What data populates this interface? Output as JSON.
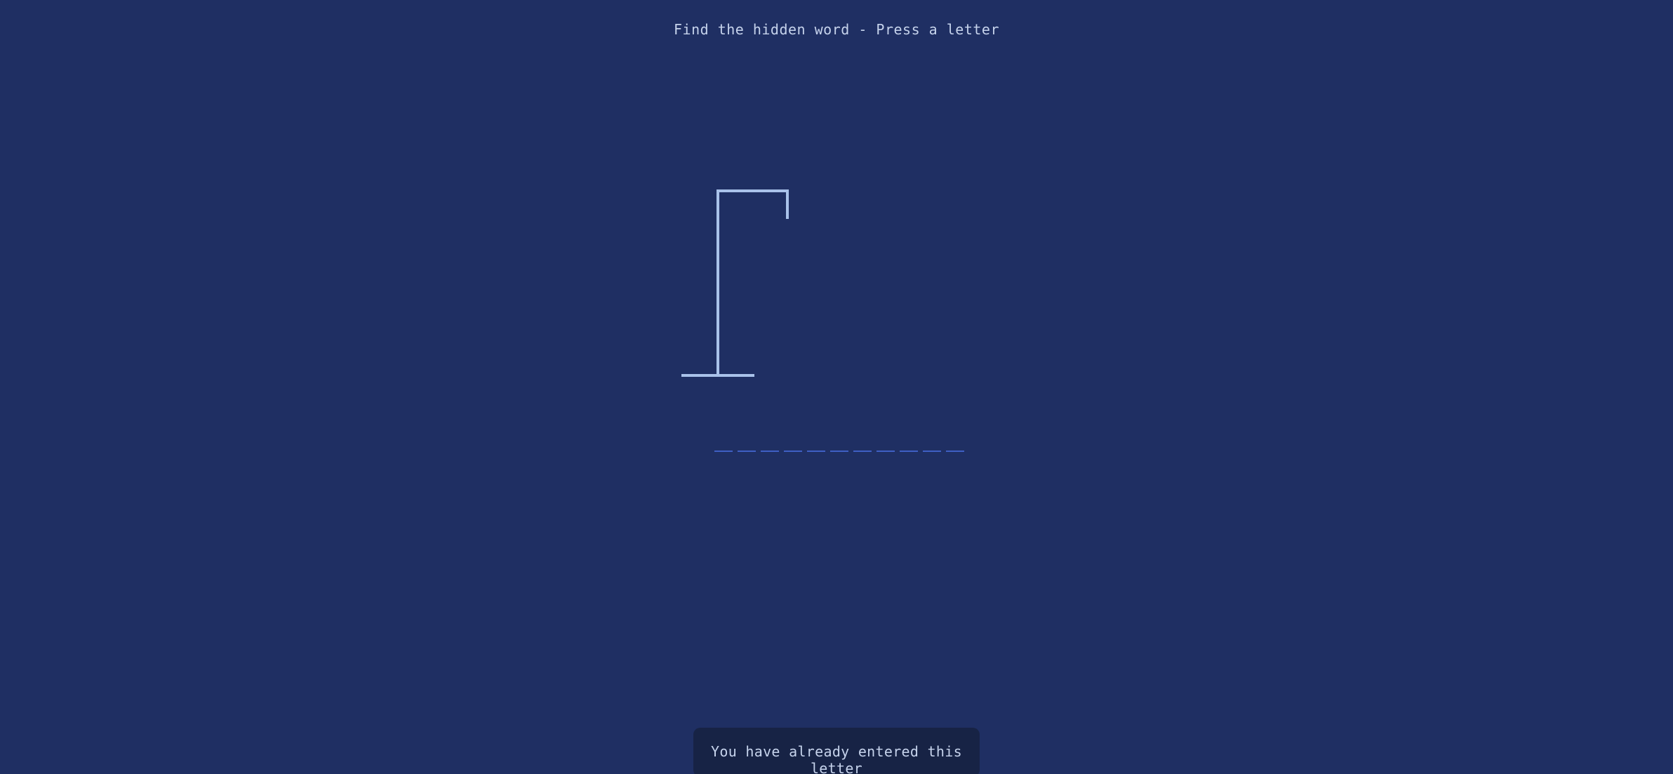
{
  "header": {
    "instruction": "Find the hidden word - Press a letter"
  },
  "game": {
    "word_letters": [
      "",
      "",
      "",
      "",
      "",
      "",
      "",
      "",
      "",
      "",
      ""
    ],
    "drawing_stage": "gallows-only",
    "colors": {
      "background": "#1f2f63",
      "gallows": "#a9c2ea",
      "slot_underline": "#3f5fc4",
      "text": "#c6d3ec",
      "notice_background": "#172345"
    }
  },
  "notification": {
    "message": "You have already entered this letter"
  }
}
